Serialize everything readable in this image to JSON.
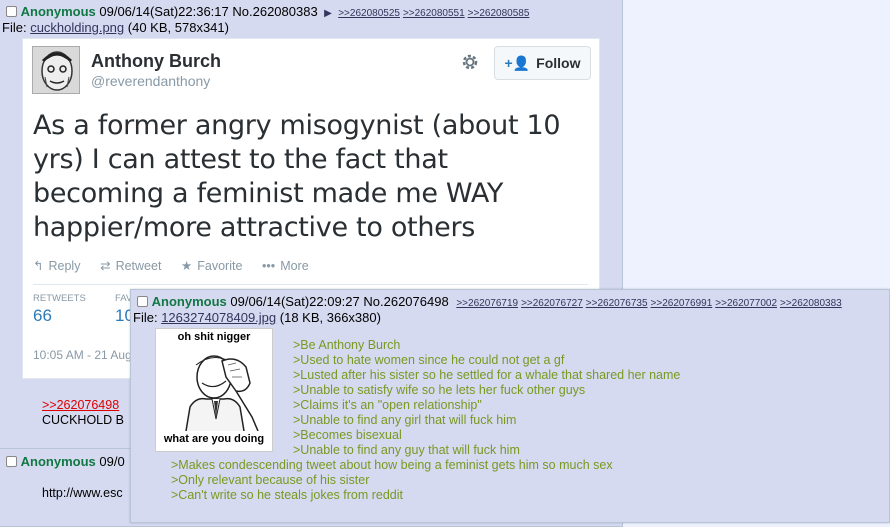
{
  "main_post": {
    "name": "Anonymous",
    "datetime": "09/06/14(Sat)22:36:17",
    "post_no": "No.262080383",
    "backlinks": [
      ">>262080525",
      ">>262080551",
      ">>262080585"
    ],
    "file_label": "File:",
    "file_name": "cuckholding.png",
    "file_meta": "(40 KB, 578x341)"
  },
  "tweet": {
    "display_name": "Anthony Burch",
    "handle": "@reverendanthony",
    "follow_label": "Follow",
    "text": "As a former angry misogynist (about 10 yrs) I can attest to the fact that becoming a feminist made me WAY happier/more attractive to others",
    "actions": [
      "Reply",
      "Retweet",
      "Favorite",
      "More"
    ],
    "retweets_label": "RETWEETS",
    "retweets_value": "66",
    "favorites_label": "FAV",
    "favorites_value": "10",
    "timestamp": "10:05 AM - 21 Aug"
  },
  "reply_quote": {
    "quote_link": ">>262076498",
    "text": "CUCKHOLD B"
  },
  "post2": {
    "name": "Anonymous",
    "datetime": "09/0",
    "text": "http://www.esc"
  },
  "popup": {
    "name": "Anonymous",
    "datetime": "09/06/14(Sat)22:09:27",
    "post_no": "No.262076498",
    "backlinks": [
      ">>262076719",
      ">>262076727",
      ">>262076735",
      ">>262076991",
      ">>262077002",
      ">>262080383"
    ],
    "file_label": "File:",
    "file_name": "1263274078409.jpg",
    "file_meta": "(18 KB, 366x380)",
    "image_top_text": "oh shit nigger",
    "image_bottom_text": "what are you doing",
    "lines": [
      ">Be Anthony Burch",
      ">Used to hate women since he could not get a gf",
      ">Lusted after his sister so he settled for a whale that shared her name",
      ">Unable to satisfy wife so he lets her fuck other guys",
      ">Claims it's an \"open relationship\"",
      ">Unable to find any girl that will fuck him",
      ">Becomes bisexual",
      ">Unable to find any guy that will fuck him",
      ">Makes condescending tweet about how being a feminist gets him so much sex",
      ">Only relevant because of his sister",
      ">Can't write so he steals jokes from reddit"
    ]
  },
  "colors": {
    "page_bg": "#eef2ff",
    "post_bg": "#d6daf0",
    "name": "#117743",
    "greentext": "#789922",
    "link": "#34345c",
    "quote_link": "#dd0000",
    "twitter_accent": "#2b7bb9"
  }
}
